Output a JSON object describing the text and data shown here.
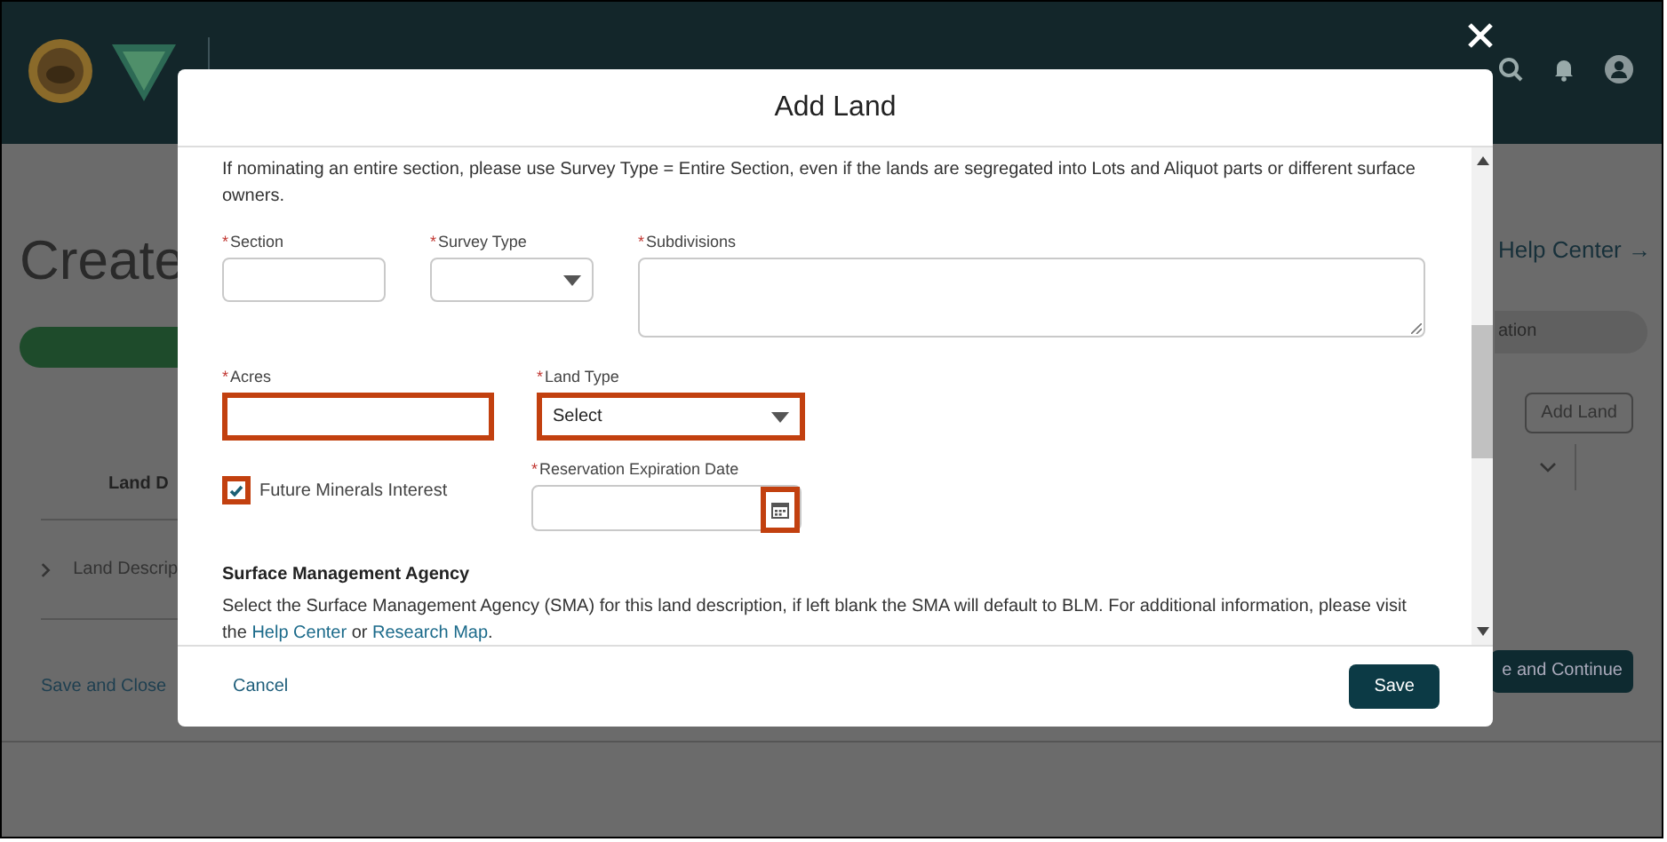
{
  "page": {
    "title": "Create",
    "help_link": "Help Center →",
    "progress_step": "ation",
    "add_land_button": "Add Land",
    "table_header": "Land D",
    "row_label": "Land Descrip",
    "save_and_close": "Save and Close",
    "continue_button": "e and Continue"
  },
  "modal": {
    "title": "Add Land",
    "intro": "If nominating an entire section, please use Survey Type = Entire Section, even if the lands are segregated into Lots and Aliquot parts or different surface owners.",
    "rows": [
      [
        {
          "kind": "text",
          "label": "Section",
          "required_mark": "*",
          "highlighted": false
        },
        {
          "kind": "select",
          "label": "Survey Type",
          "required_mark": "*",
          "highlighted": false
        },
        {
          "kind": "textarea",
          "label": "Subdivisions",
          "required_mark": "*",
          "highlighted": false
        }
      ],
      [
        {
          "kind": "text",
          "label": "Acres",
          "required_mark": "*",
          "highlighted": true
        },
        {
          "kind": "select",
          "label": "Land Type",
          "required_mark": "*",
          "highlighted": true,
          "value": "Select"
        }
      ],
      [
        {
          "kind": "checkbox",
          "label": "Future Minerals Interest",
          "checked": true,
          "highlighted": true
        },
        {
          "kind": "date",
          "label": "Reservation Expiration Date",
          "required_mark": "*",
          "highlighted": true
        }
      ]
    ],
    "sma_heading": "Surface Management Agency",
    "sma_text": [
      {
        "kind": "text",
        "text": "Select the Surface Management Agency (SMA) for this land description, if left blank the SMA will default to BLM. For additional information, please visit the "
      },
      {
        "kind": "link",
        "text": "Help Center"
      },
      {
        "kind": "text",
        "text": " or "
      },
      {
        "kind": "link",
        "text": "Research Map"
      },
      {
        "kind": "text",
        "text": "."
      }
    ],
    "cancel": "Cancel",
    "save": "Save"
  }
}
